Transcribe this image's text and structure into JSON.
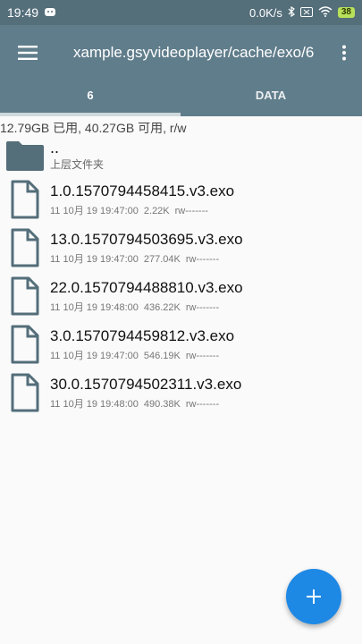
{
  "status": {
    "time": "19:49",
    "speed": "0.0K/s",
    "battery": "38"
  },
  "appbar": {
    "title": "xample.gsyvideoplayer/cache/exo/6"
  },
  "tabs": [
    {
      "label": "6"
    },
    {
      "label": "DATA"
    }
  ],
  "storage_info": "12.79GB 已用, 40.27GB 可用, r/w",
  "parent": {
    "name": "..",
    "label": "上层文件夹"
  },
  "files": [
    {
      "name": "1.0.1570794458415.v3.exo",
      "date": "11 10月 19 19:47:00",
      "size": "2.22K",
      "perm": "rw-------"
    },
    {
      "name": "13.0.1570794503695.v3.exo",
      "date": "11 10月 19 19:47:00",
      "size": "277.04K",
      "perm": "rw-------"
    },
    {
      "name": "22.0.1570794488810.v3.exo",
      "date": "11 10月 19 19:48:00",
      "size": "436.22K",
      "perm": "rw-------"
    },
    {
      "name": "3.0.1570794459812.v3.exo",
      "date": "11 10月 19 19:47:00",
      "size": "546.19K",
      "perm": "rw-------"
    },
    {
      "name": "30.0.1570794502311.v3.exo",
      "date": "11 10月 19 19:48:00",
      "size": "490.38K",
      "perm": "rw-------"
    }
  ],
  "colors": {
    "appbar": "#607d8b",
    "statusbar": "#546e7a",
    "fab": "#1e88e5",
    "file_icon": "#546e7a"
  }
}
